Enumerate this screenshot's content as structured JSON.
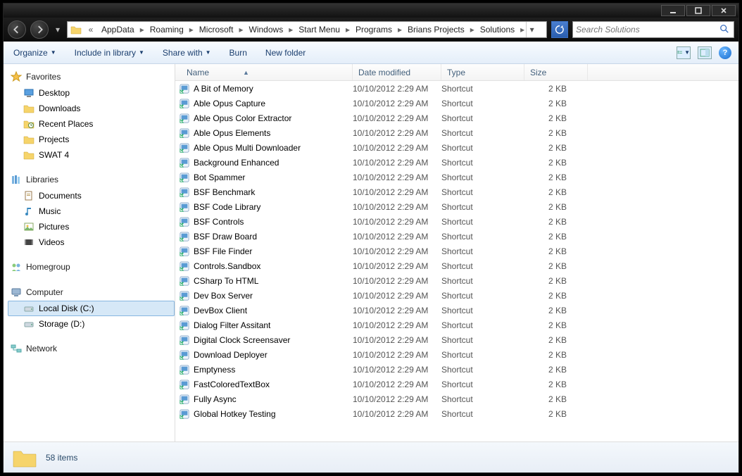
{
  "breadcrumb": {
    "leading_chevrons": "«",
    "parts": [
      "AppData",
      "Roaming",
      "Microsoft",
      "Windows",
      "Start Menu",
      "Programs",
      "Brians Projects",
      "Solutions"
    ]
  },
  "search": {
    "placeholder": "Search Solutions"
  },
  "toolbar": {
    "organize": "Organize",
    "include": "Include in library",
    "share": "Share with",
    "burn": "Burn",
    "newfolder": "New folder"
  },
  "sidebar": {
    "favorites": {
      "label": "Favorites",
      "items": [
        {
          "label": "Desktop",
          "icon": "desktop"
        },
        {
          "label": "Downloads",
          "icon": "folder"
        },
        {
          "label": "Recent Places",
          "icon": "recent"
        },
        {
          "label": "Projects",
          "icon": "folder"
        },
        {
          "label": "SWAT 4",
          "icon": "folder"
        }
      ]
    },
    "libraries": {
      "label": "Libraries",
      "items": [
        {
          "label": "Documents",
          "icon": "doc"
        },
        {
          "label": "Music",
          "icon": "music"
        },
        {
          "label": "Pictures",
          "icon": "pic"
        },
        {
          "label": "Videos",
          "icon": "video"
        }
      ]
    },
    "homegroup": {
      "label": "Homegroup"
    },
    "computer": {
      "label": "Computer",
      "items": [
        {
          "label": "Local Disk (C:)",
          "icon": "drive",
          "selected": true
        },
        {
          "label": "Storage (D:)",
          "icon": "drive"
        }
      ]
    },
    "network": {
      "label": "Network"
    }
  },
  "columns": {
    "name": "Name",
    "date": "Date modified",
    "type": "Type",
    "size": "Size"
  },
  "files": [
    {
      "name": "A Bit of Memory",
      "date": "10/10/2012 2:29 AM",
      "type": "Shortcut",
      "size": "2 KB"
    },
    {
      "name": "Able Opus Capture",
      "date": "10/10/2012 2:29 AM",
      "type": "Shortcut",
      "size": "2 KB"
    },
    {
      "name": "Able Opus Color Extractor",
      "date": "10/10/2012 2:29 AM",
      "type": "Shortcut",
      "size": "2 KB"
    },
    {
      "name": "Able Opus Elements",
      "date": "10/10/2012 2:29 AM",
      "type": "Shortcut",
      "size": "2 KB"
    },
    {
      "name": "Able Opus Multi Downloader",
      "date": "10/10/2012 2:29 AM",
      "type": "Shortcut",
      "size": "2 KB"
    },
    {
      "name": "Background Enhanced",
      "date": "10/10/2012 2:29 AM",
      "type": "Shortcut",
      "size": "2 KB"
    },
    {
      "name": "Bot Spammer",
      "date": "10/10/2012 2:29 AM",
      "type": "Shortcut",
      "size": "2 KB"
    },
    {
      "name": "BSF Benchmark",
      "date": "10/10/2012 2:29 AM",
      "type": "Shortcut",
      "size": "2 KB"
    },
    {
      "name": "BSF Code Library",
      "date": "10/10/2012 2:29 AM",
      "type": "Shortcut",
      "size": "2 KB"
    },
    {
      "name": "BSF Controls",
      "date": "10/10/2012 2:29 AM",
      "type": "Shortcut",
      "size": "2 KB"
    },
    {
      "name": "BSF Draw Board",
      "date": "10/10/2012 2:29 AM",
      "type": "Shortcut",
      "size": "2 KB"
    },
    {
      "name": "BSF File Finder",
      "date": "10/10/2012 2:29 AM",
      "type": "Shortcut",
      "size": "2 KB"
    },
    {
      "name": "Controls.Sandbox",
      "date": "10/10/2012 2:29 AM",
      "type": "Shortcut",
      "size": "2 KB"
    },
    {
      "name": "CSharp To HTML",
      "date": "10/10/2012 2:29 AM",
      "type": "Shortcut",
      "size": "2 KB"
    },
    {
      "name": "Dev Box Server",
      "date": "10/10/2012 2:29 AM",
      "type": "Shortcut",
      "size": "2 KB"
    },
    {
      "name": "DevBox Client",
      "date": "10/10/2012 2:29 AM",
      "type": "Shortcut",
      "size": "2 KB"
    },
    {
      "name": "Dialog Filter Assitant",
      "date": "10/10/2012 2:29 AM",
      "type": "Shortcut",
      "size": "2 KB"
    },
    {
      "name": "Digital Clock Screensaver",
      "date": "10/10/2012 2:29 AM",
      "type": "Shortcut",
      "size": "2 KB"
    },
    {
      "name": "Download Deployer",
      "date": "10/10/2012 2:29 AM",
      "type": "Shortcut",
      "size": "2 KB"
    },
    {
      "name": "Emptyness",
      "date": "10/10/2012 2:29 AM",
      "type": "Shortcut",
      "size": "2 KB"
    },
    {
      "name": "FastColoredTextBox",
      "date": "10/10/2012 2:29 AM",
      "type": "Shortcut",
      "size": "2 KB"
    },
    {
      "name": "Fully Async",
      "date": "10/10/2012 2:29 AM",
      "type": "Shortcut",
      "size": "2 KB"
    },
    {
      "name": "Global Hotkey Testing",
      "date": "10/10/2012 2:29 AM",
      "type": "Shortcut",
      "size": "2 KB"
    }
  ],
  "status": {
    "count_text": "58 items"
  }
}
